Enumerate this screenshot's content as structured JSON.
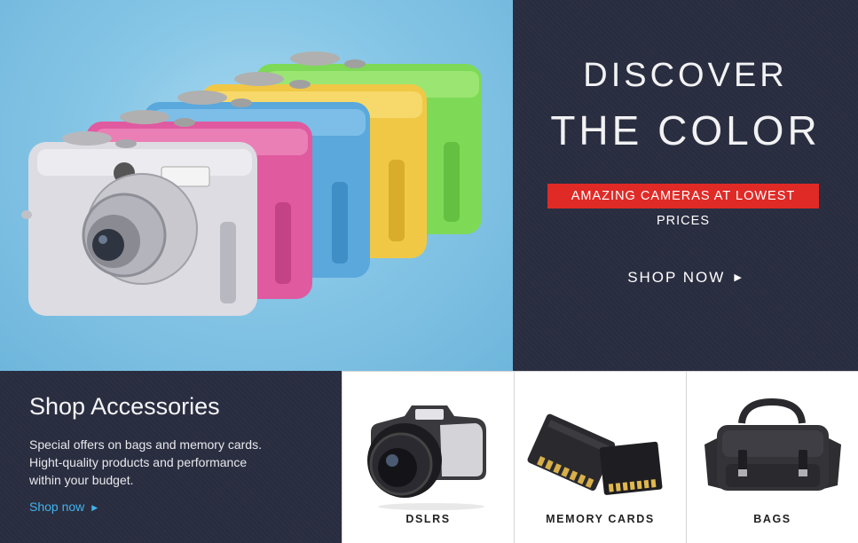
{
  "hero": {
    "line1": "DISCOVER",
    "line2": "THE COLOR",
    "badge": "AMAZING CAMERAS AT LOWEST PRICES",
    "cta": "SHOP NOW",
    "cta_arrow": "▶",
    "camera_colors": [
      "#7ed957",
      "#f0c846",
      "#5aa8dc",
      "#e05aa0",
      "#d8d8e0"
    ]
  },
  "accessories": {
    "title": "Shop Accessories",
    "description_lines": [
      "Special offers on bags and memory cards.",
      "Hight-quality products and performance",
      "within your budget."
    ],
    "link": "Shop now",
    "link_arrow": "▶"
  },
  "tiles": [
    {
      "label": "DSLRS",
      "icon": "dslr-camera-image"
    },
    {
      "label": "MEMORY CARDS",
      "icon": "memory-card-image"
    },
    {
      "label": "BAGS",
      "icon": "camera-bag-image"
    }
  ],
  "colors": {
    "dark_panel": "#2a2e40",
    "badge_red": "#e02a26",
    "link_blue": "#43b3ee",
    "hero_sky": "#86c6e6"
  }
}
